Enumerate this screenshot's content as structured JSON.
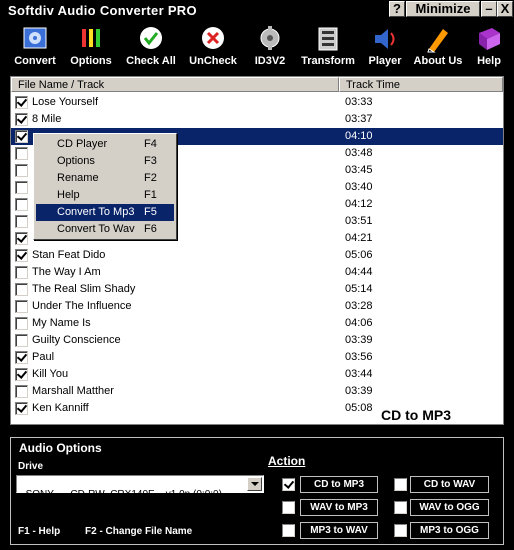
{
  "window": {
    "title": "Softdiv Audio Converter PRO",
    "help_btn": "?",
    "minimize_label": "Minimize",
    "min_btn": "–",
    "close_btn": "X"
  },
  "toolbar": [
    {
      "label": "Convert",
      "icon": "convert-icon"
    },
    {
      "label": "Options",
      "icon": "options-icon"
    },
    {
      "label": "Check All",
      "icon": "check-all-icon"
    },
    {
      "label": "UnCheck",
      "icon": "uncheck-icon"
    },
    {
      "label": "ID3V2",
      "icon": "id3v2-icon"
    },
    {
      "label": "Transform",
      "icon": "transform-icon"
    },
    {
      "label": "Player",
      "icon": "player-icon"
    },
    {
      "label": "About Us",
      "icon": "about-icon"
    },
    {
      "label": "Help",
      "icon": "help-book-icon"
    }
  ],
  "list": {
    "col_name": "File Name / Track",
    "col_time": "Track Time",
    "watermark": "CD to MP3",
    "rows": [
      {
        "name": "Lose Yourself",
        "time": "03:33",
        "checked": true
      },
      {
        "name": "8 Mile",
        "time": "03:37",
        "checked": true
      },
      {
        "name": "",
        "time": "04:10",
        "checked": true,
        "selected": true
      },
      {
        "name": "",
        "time": "03:48",
        "checked": false
      },
      {
        "name": "",
        "time": "03:45",
        "checked": false
      },
      {
        "name": "",
        "time": "03:40",
        "checked": false
      },
      {
        "name": "",
        "time": "04:12",
        "checked": false
      },
      {
        "name": "",
        "time": "03:51",
        "checked": false
      },
      {
        "name": "",
        "time": "04:21",
        "checked": true
      },
      {
        "name": "Stan Feat Dido",
        "time": "05:06",
        "checked": true
      },
      {
        "name": "The Way I Am",
        "time": "04:44",
        "checked": false
      },
      {
        "name": "The Real Slim Shady",
        "time": "05:14",
        "checked": false
      },
      {
        "name": "Under The Influence",
        "time": "03:28",
        "checked": false
      },
      {
        "name": "My Name Is",
        "time": "04:06",
        "checked": false
      },
      {
        "name": "Guilty Conscience",
        "time": "03:39",
        "checked": false
      },
      {
        "name": "Paul",
        "time": "03:56",
        "checked": true
      },
      {
        "name": "Kill You",
        "time": "03:44",
        "checked": true
      },
      {
        "name": "Marshall Matther",
        "time": "03:39",
        "checked": false
      },
      {
        "name": "Ken Kanniff",
        "time": "05:08",
        "checked": true
      }
    ]
  },
  "context_menu": [
    {
      "label": "CD Player",
      "key": "F4"
    },
    {
      "label": "Options",
      "key": "F3"
    },
    {
      "label": "Rename",
      "key": "F2"
    },
    {
      "label": "Help",
      "key": "F1"
    },
    {
      "label": "Convert To Mp3",
      "key": "F5",
      "highlighted": true
    },
    {
      "label": "Convert To Wav",
      "key": "F6"
    }
  ],
  "audio_options": {
    "title": "Audio Options",
    "drive_label": "Drive",
    "drive_value": "SONY    , CD-RW  CRX140E    v1.0n (0:0:0)",
    "action_label": "Action",
    "hint_help": "F1 - Help",
    "hint_rename": "F2 - Change File Name",
    "actions": [
      {
        "label": "CD to MP3",
        "checked": true
      },
      {
        "label": "CD to WAV",
        "checked": false
      },
      {
        "label": "WAV to MP3",
        "checked": false
      },
      {
        "label": "WAV to OGG",
        "checked": false
      },
      {
        "label": "MP3 to WAV",
        "checked": false
      },
      {
        "label": "MP3 to OGG",
        "checked": false
      }
    ]
  },
  "colors": {
    "selection": "#0a246a",
    "chrome": "#d4d0c8",
    "background": "#000000"
  }
}
